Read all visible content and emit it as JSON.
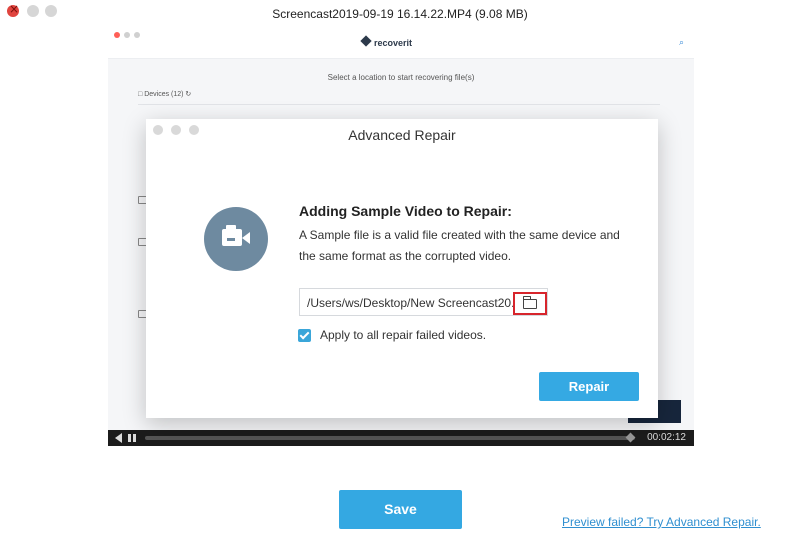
{
  "window": {
    "title": "Screencast2019-09-19 16.14.22.MP4 (9.08 MB)"
  },
  "background_app": {
    "brand": "recoverit",
    "subtitle": "Select a location to start recovering file(s)",
    "devices_label": "Devices (12)"
  },
  "player": {
    "time": "00:02:12"
  },
  "dialog": {
    "title": "Advanced Repair",
    "heading": "Adding Sample Video to Repair:",
    "description": "A Sample file is a valid file created with the same device and the same format as the corrupted video.",
    "path": "/Users/ws/Desktop/New Screencast20...",
    "checkbox_label": "Apply to all repair failed videos.",
    "checkbox_checked": true,
    "repair_label": "Repair"
  },
  "bottom": {
    "save_label": "Save",
    "advanced_link": "Preview failed? Try Advanced Repair."
  },
  "colors": {
    "accent": "#34a8e2",
    "close_red": "#e0443e",
    "highlight_red": "#d7252c",
    "camera_circle": "#6e8aa0"
  },
  "icons": [
    "close-icon",
    "camera-icon",
    "folder-icon",
    "checkbox-icon",
    "speaker-icon",
    "pause-icon",
    "search-icon"
  ]
}
